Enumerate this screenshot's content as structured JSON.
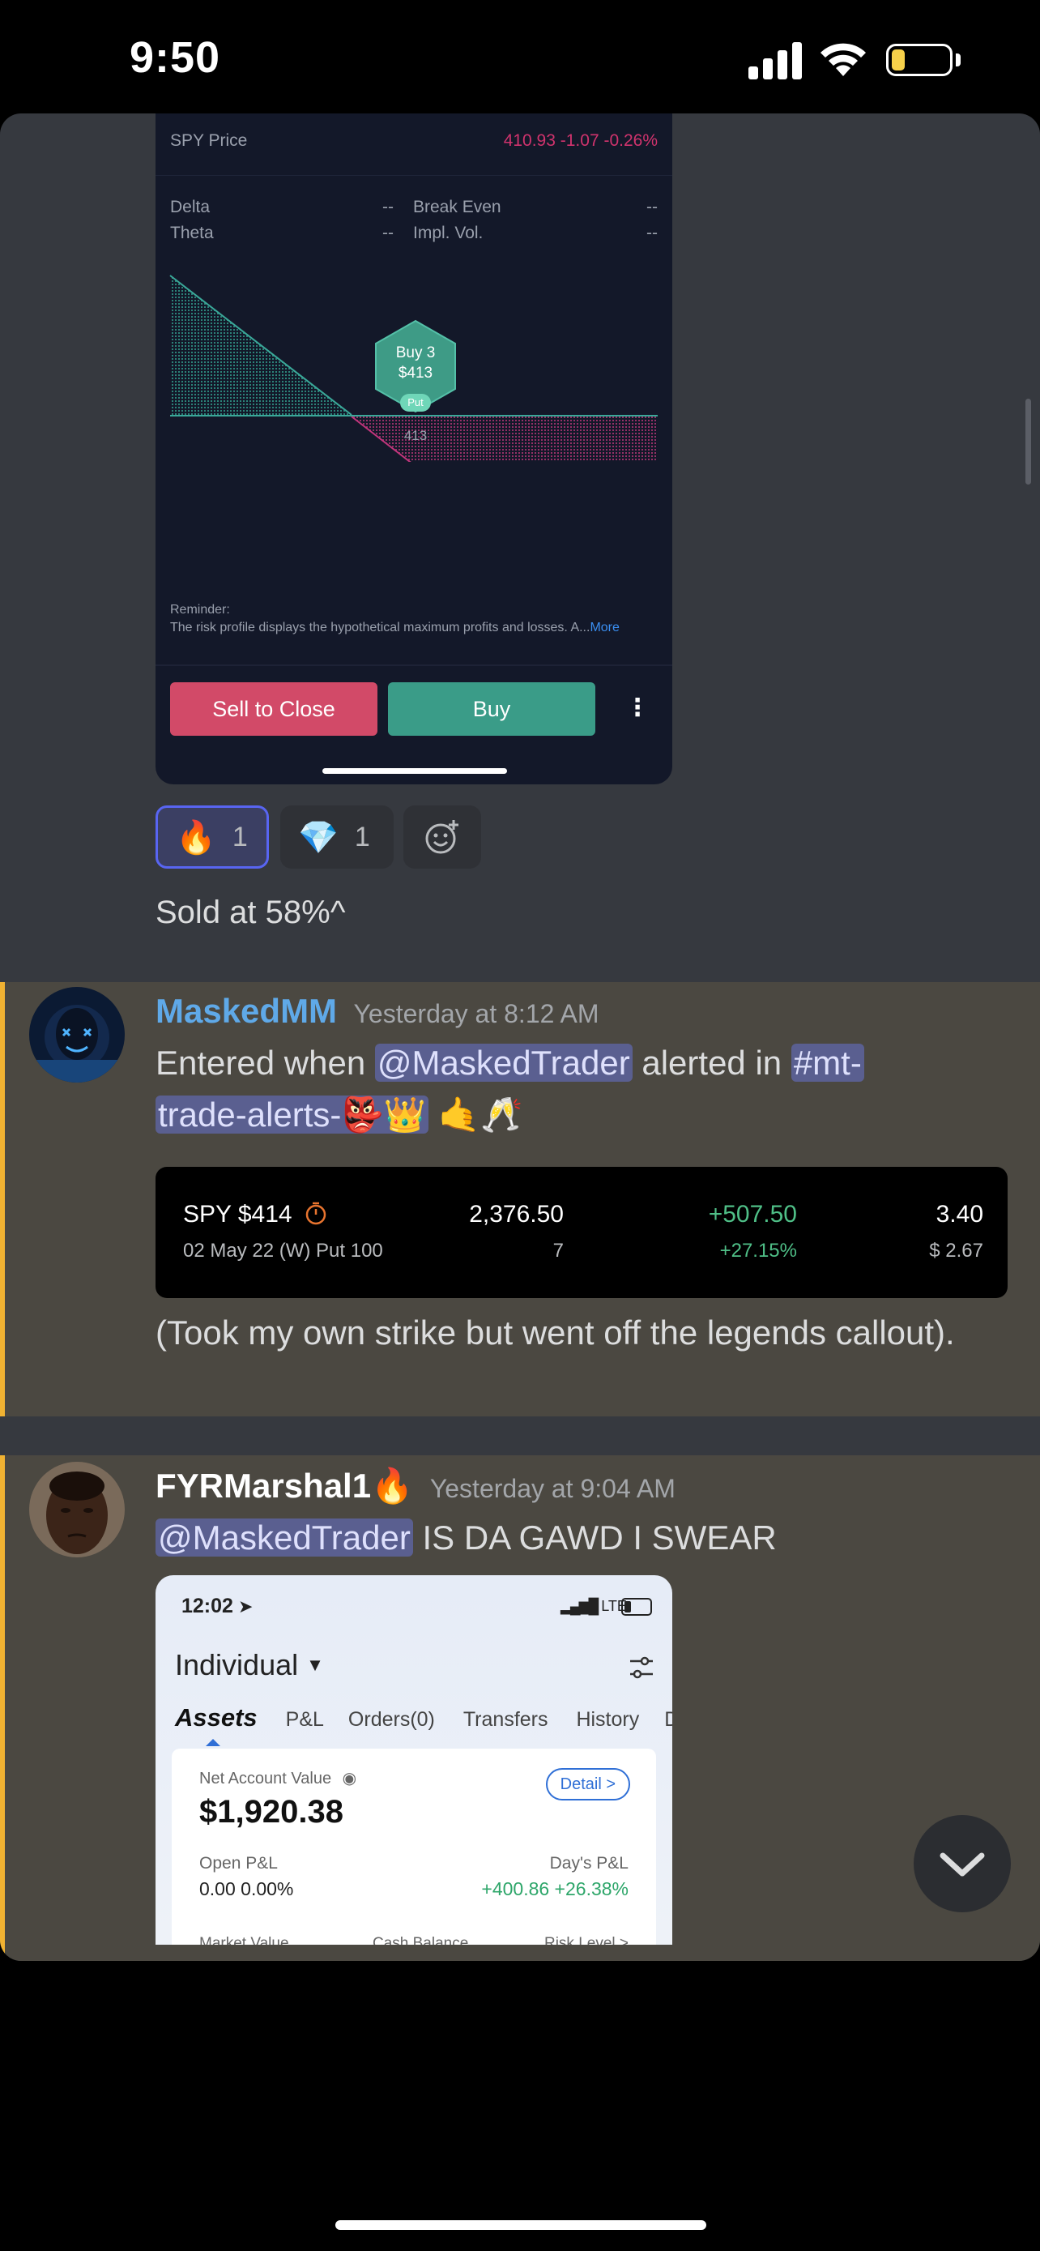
{
  "status_bar": {
    "time": "9:50"
  },
  "card1": {
    "price_label": "SPY Price",
    "price_value": "410.93 -1.07 -0.26%",
    "delta_label": "Delta",
    "delta_value": "--",
    "theta_label": "Theta",
    "theta_value": "--",
    "breakeven_label": "Break Even",
    "breakeven_value": "--",
    "iv_label": "Impl. Vol.",
    "iv_value": "--",
    "marker_line1": "Buy 3",
    "marker_line2": "$413",
    "marker_tag": "Put",
    "strike_label": "413",
    "reminder_title": "Reminder:",
    "reminder_text": "The risk profile displays the hypothetical maximum profits and losses. A...",
    "reminder_more": "More",
    "sell_label": "Sell to Close",
    "buy_label": "Buy"
  },
  "reactions": [
    {
      "emoji": "🔥",
      "count": "1"
    },
    {
      "emoji": "💎",
      "count": "1"
    }
  ],
  "msg0": {
    "text": "Sold at 58%^"
  },
  "msg1": {
    "username": "MaskedMM",
    "username_color": "#5fa9e8",
    "timestamp": "Yesterday at 8:12 AM",
    "text_a": "Entered when ",
    "mention": "@MaskedTrader",
    "text_b": " alerted in ",
    "channel_a": "#mt-",
    "channel_b": "trade-alerts-",
    "emojis_tail": "🤙🥂",
    "channel_emojis": "👺👑"
  },
  "embed": {
    "ticker": "SPY $414",
    "contract": "02 May 22 (W) Put 100",
    "value": "2,376.50",
    "qty": "7",
    "pnl": "+507.50",
    "pnl_pct": "+27.15%",
    "price": "3.40",
    "cost": "$ 2.67"
  },
  "msg2": {
    "text": "(Took my own strike but went off the legends callout)."
  },
  "msg3": {
    "username": "FYRMarshal1🔥",
    "timestamp": "Yesterday at 9:04 AM",
    "mention": "@MaskedTrader",
    "text": " IS DA GAWD I SWEAR"
  },
  "card2": {
    "time": "12:02",
    "network": "LTE",
    "account": "Individual",
    "tabs": [
      "Assets",
      "P&L",
      "Orders(0)",
      "Transfers",
      "History",
      "Do"
    ],
    "nav_label": "Net Account Value",
    "nav_value": "$1,920.38",
    "detail_label": "Detail >",
    "open_pnl_label": "Open P&L",
    "open_pnl_value": "0.00 0.00%",
    "day_pnl_label": "Day's P&L",
    "day_pnl_value": "+400.86 +26.38%",
    "bottom_labels": [
      "Market Value",
      "Cash Balance",
      "Risk Level >"
    ]
  }
}
